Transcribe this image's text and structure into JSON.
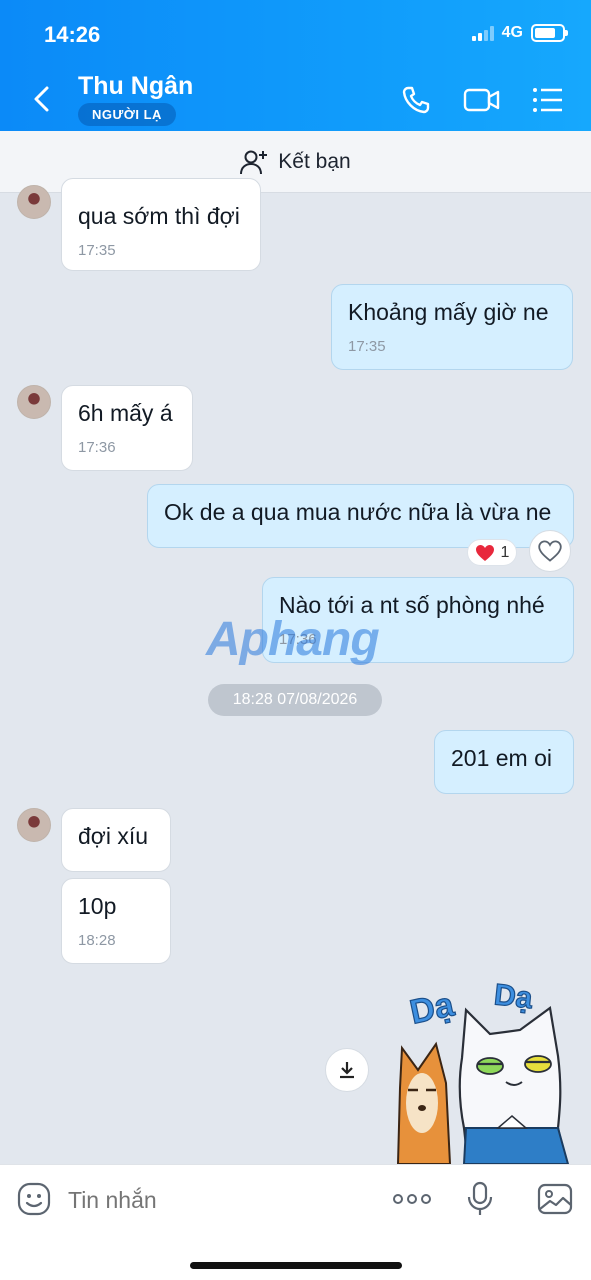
{
  "status": {
    "time": "14:26",
    "network": "4G"
  },
  "header": {
    "name": "Thu Ngân",
    "tag": "NGƯỜI LẠ"
  },
  "addbar": {
    "label": "Kết bạn"
  },
  "messages": {
    "m1": {
      "text": "qua sớm thì đợi",
      "time": "17:35"
    },
    "m2": {
      "text": "Khoảng mấy giờ ne",
      "time": "17:35"
    },
    "m3": {
      "text": "6h mấy á",
      "time": "17:36"
    },
    "m4": {
      "text": "Ok de a qua mua nước nữa là vừa ne",
      "reaction_count": "1"
    },
    "m5": {
      "text": "Nào tới a nt số phòng nhé",
      "time": "17:36"
    },
    "date_divider": "18:28 07/08/2026",
    "m6": {
      "text": "201 em oi"
    },
    "m7": {
      "text": "đợi xíu"
    },
    "m8": {
      "text": "10p",
      "time": "18:28"
    }
  },
  "sticker": {
    "text1": "Dạ",
    "text2": "Dạ"
  },
  "watermark": {
    "text": "Aphang"
  },
  "input": {
    "placeholder": "Tin nhắn"
  },
  "colors": {
    "header": "#0b8af8",
    "outgoing": "#d5efff",
    "incoming": "#ffffff",
    "background": "#e2e7ee"
  }
}
